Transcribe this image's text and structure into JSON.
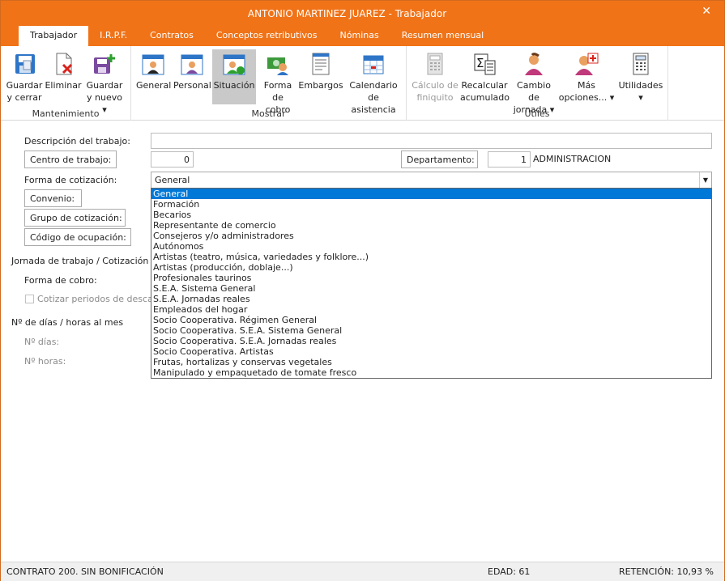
{
  "window": {
    "title": "ANTONIO MARTINEZ JUAREZ - Trabajador",
    "close": "✕"
  },
  "tabs": [
    "Trabajador",
    "I.R.P.F.",
    "Contratos",
    "Conceptos retributivos",
    "Nóminas",
    "Resumen mensual"
  ],
  "ribbon": {
    "groups": [
      "Mantenimiento",
      "Mostrar",
      "Útiles"
    ],
    "buttons": {
      "guardar_cerrar": "Guardar\ny cerrar",
      "eliminar": "Eliminar",
      "guardar_nuevo": "Guardar\ny nuevo ▾",
      "general": "General",
      "personal": "Personal",
      "situacion": "Situación",
      "forma_cobro": "Forma\nde cobro",
      "embargos": "Embargos",
      "calendario": "Calendario\nde asistencia",
      "calculo_finiquito": "Cálculo de\nfiniquito",
      "recalcular": "Recalcular\nacumulado",
      "cambio_jornada": "Cambio de\njornada ▾",
      "mas_opciones": "Más\nopciones... ▾",
      "utilidades": "Utilidades\n▾"
    }
  },
  "form": {
    "descripcion_label": "Descripción del trabajo:",
    "descripcion_value": "",
    "centro_label": "Centro de trabajo:",
    "centro_value": "0",
    "departamento_label": "Departamento:",
    "departamento_value": "1",
    "departamento_name": "ADMINISTRACION",
    "forma_cotizacion_label": "Forma de cotización:",
    "forma_cotizacion_value": "General",
    "convenio_label": "Convenio:",
    "grupo_label": "Grupo de cotización:",
    "codigo_label": "Código de ocupación:",
    "jornada_label": "Jornada de trabajo / Cotización a",
    "forma_cobro_label": "Forma de cobro:",
    "cotizar_label": "Cotizar periodos de descan",
    "dias_horas_label": "Nº de días / horas al mes",
    "dias_label": "Nº días:",
    "horas_label": "Nº horas:"
  },
  "dropdown": {
    "selected_index": 0,
    "options": [
      "General",
      "Formación",
      "Becarios",
      "Representante de comercio",
      "Consejeros y/o administradores",
      "Autónomos",
      "Artistas (teatro, música, variedades y folklore...)",
      "Artistas (producción, doblaje...)",
      "Profesionales taurinos",
      "S.E.A. Sistema General",
      "S.E.A. Jornadas reales",
      "Empleados del hogar",
      "Socio Cooperativa. Régimen General",
      "Socio Cooperativa. S.E.A. Sistema General",
      "Socio Cooperativa. S.E.A. Jornadas reales",
      "Socio Cooperativa. Artistas",
      "Frutas, hortalizas y conservas vegetales",
      "Manipulado y empaquetado de tomate fresco"
    ]
  },
  "status": {
    "contrato": "CONTRATO 200.  SIN BONIFICACIÓN",
    "edad": "EDAD: 61",
    "retencion": "RETENCIÓN: 10,93 %"
  },
  "colors": {
    "accent": "#f07318",
    "selection": "#0078d7"
  }
}
